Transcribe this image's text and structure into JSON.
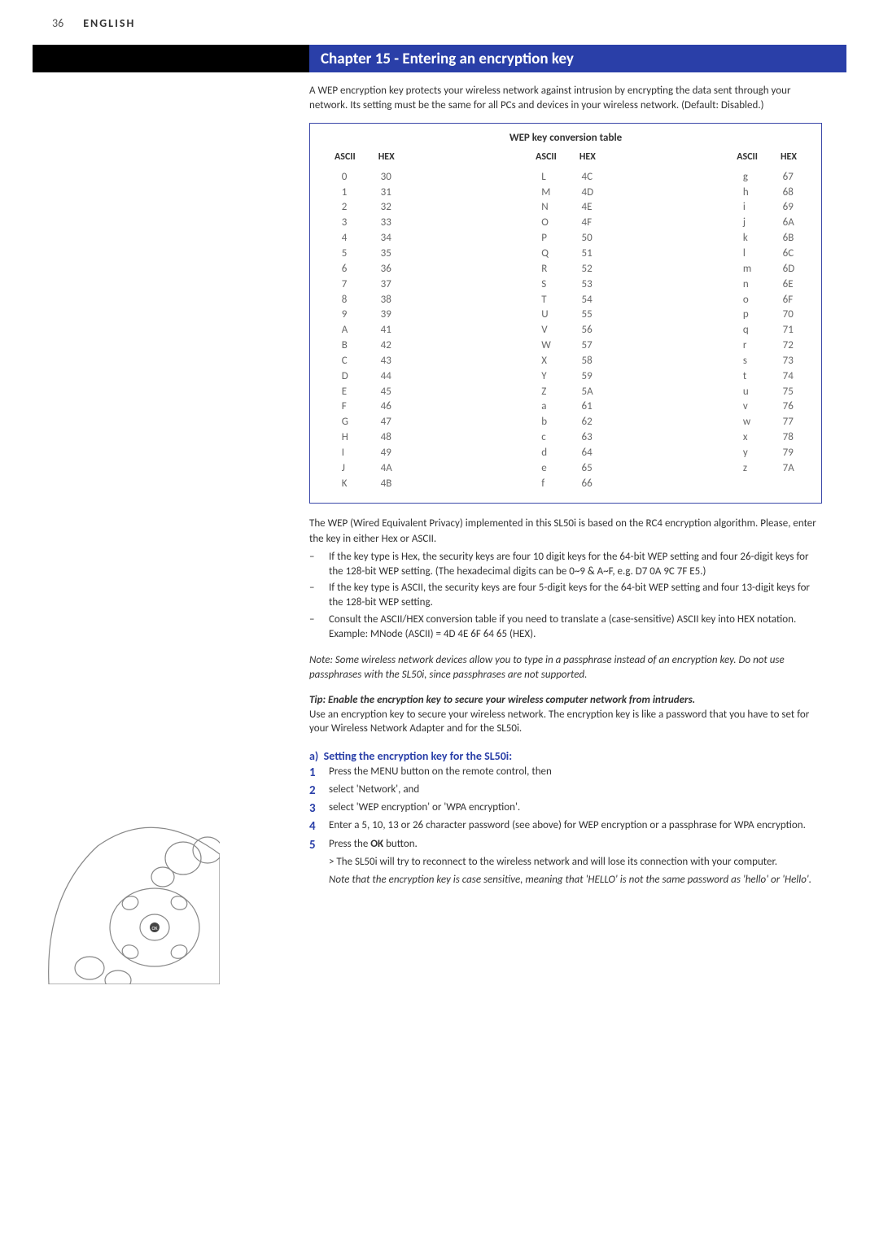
{
  "page_number": "36",
  "language": "ENGLISH",
  "chapter_title": "Chapter 15 - Entering an encryption key",
  "intro": "A WEP encryption key protects your wireless network against intrusion by encrypting the data sent through your network. Its setting must be the same for all PCs and devices in your wireless network. (Default: Disabled.)",
  "table": {
    "title": "WEP key conversion table",
    "head_ascii": "ASCII",
    "head_hex": "HEX",
    "col1": [
      {
        "a": "0",
        "h": "30"
      },
      {
        "a": "1",
        "h": "31"
      },
      {
        "a": "2",
        "h": "32"
      },
      {
        "a": "3",
        "h": "33"
      },
      {
        "a": "4",
        "h": "34"
      },
      {
        "a": "5",
        "h": "35"
      },
      {
        "a": "6",
        "h": "36"
      },
      {
        "a": "7",
        "h": "37"
      },
      {
        "a": "8",
        "h": "38"
      },
      {
        "a": "9",
        "h": "39"
      },
      {
        "a": "A",
        "h": "41"
      },
      {
        "a": "B",
        "h": "42"
      },
      {
        "a": "C",
        "h": "43"
      },
      {
        "a": "D",
        "h": "44"
      },
      {
        "a": "E",
        "h": "45"
      },
      {
        "a": "F",
        "h": "46"
      },
      {
        "a": "G",
        "h": "47"
      },
      {
        "a": "H",
        "h": "48"
      },
      {
        "a": "I",
        "h": "49"
      },
      {
        "a": "J",
        "h": "4A"
      },
      {
        "a": "K",
        "h": "4B"
      }
    ],
    "col2": [
      {
        "a": "L",
        "h": "4C"
      },
      {
        "a": "M",
        "h": "4D"
      },
      {
        "a": "N",
        "h": "4E"
      },
      {
        "a": "O",
        "h": "4F"
      },
      {
        "a": "P",
        "h": "50"
      },
      {
        "a": "Q",
        "h": "51"
      },
      {
        "a": "R",
        "h": "52"
      },
      {
        "a": "S",
        "h": "53"
      },
      {
        "a": "T",
        "h": "54"
      },
      {
        "a": "U",
        "h": "55"
      },
      {
        "a": "V",
        "h": "56"
      },
      {
        "a": "W",
        "h": "57"
      },
      {
        "a": "X",
        "h": "58"
      },
      {
        "a": "Y",
        "h": "59"
      },
      {
        "a": "Z",
        "h": "5A"
      },
      {
        "a": "a",
        "h": "61"
      },
      {
        "a": "b",
        "h": "62"
      },
      {
        "a": "c",
        "h": "63"
      },
      {
        "a": "d",
        "h": "64"
      },
      {
        "a": "e",
        "h": "65"
      },
      {
        "a": "f",
        "h": "66"
      }
    ],
    "col3": [
      {
        "a": "g",
        "h": "67"
      },
      {
        "a": "h",
        "h": "68"
      },
      {
        "a": "i",
        "h": "69"
      },
      {
        "a": "j",
        "h": "6A"
      },
      {
        "a": "k",
        "h": "6B"
      },
      {
        "a": "l",
        "h": "6C"
      },
      {
        "a": "m",
        "h": "6D"
      },
      {
        "a": "n",
        "h": "6E"
      },
      {
        "a": "o",
        "h": "6F"
      },
      {
        "a": "p",
        "h": "70"
      },
      {
        "a": "q",
        "h": "71"
      },
      {
        "a": "r",
        "h": "72"
      },
      {
        "a": "s",
        "h": "73"
      },
      {
        "a": "t",
        "h": "74"
      },
      {
        "a": "u",
        "h": "75"
      },
      {
        "a": "v",
        "h": "76"
      },
      {
        "a": "w",
        "h": "77"
      },
      {
        "a": "x",
        "h": "78"
      },
      {
        "a": "y",
        "h": "79"
      },
      {
        "a": "z",
        "h": "7A"
      }
    ]
  },
  "wep_intro": "The WEP (Wired Equivalent Privacy) implemented in this SL50i is based on the RC4 encryption algorithm. Please, enter the key in either Hex or ASCII.",
  "bul1": "If the key type is Hex, the security keys are four 10 digit keys for the 64-bit WEP setting and four 26-digit keys for the 128-bit WEP setting. (The hexadecimal digits can be 0~9 & A~F, e.g. D7 0A 9C 7F E5.)",
  "bul2": "If the key type is ASCII, the security keys are four 5-digit keys for the 64-bit WEP setting and four 13-digit keys for the 128-bit WEP setting.",
  "bul3": "Consult the ASCII/HEX conversion table if you need to translate a (case-sensitive) ASCII key into HEX notation. Example: MNode (ASCII) = 4D 4E 6F 64 65 (HEX).",
  "note1": "Note: Some wireless network devices allow you to type in a passphrase instead of an encryption key. Do not use passphrases with the SL50i, since passphrases are not supported.",
  "tip_title": "Tip: Enable the encryption key to secure your wireless computer network from intruders.",
  "tip_body": "Use an encryption key to secure your wireless network. The encryption key is like a password that you have to set for your Wireless Network Adapter and for the SL50i.",
  "section_a": {
    "label": "a)",
    "title": "Setting the encryption key for the SL50i:",
    "s1": "Press the MENU button on the remote control, then",
    "s2": "select 'Network', and",
    "s3": "select 'WEP encryption' or 'WPA encryption'.",
    "s4": "Enter a 5, 10, 13 or 26 character password (see above) for WEP encryption or a passphrase for WPA encryption.",
    "s5_a": "Press the ",
    "s5_b": "OK",
    "s5_c": " button.",
    "result": "> The SL50i will try to reconnect to the wireless network and will lose its connection with your computer.",
    "note": "Note that the encryption key is case sensitive, meaning that 'HELLO' is not the same password as 'hello' or 'Hello'."
  },
  "nums": {
    "n1": "1",
    "n2": "2",
    "n3": "3",
    "n4": "4",
    "n5": "5"
  }
}
